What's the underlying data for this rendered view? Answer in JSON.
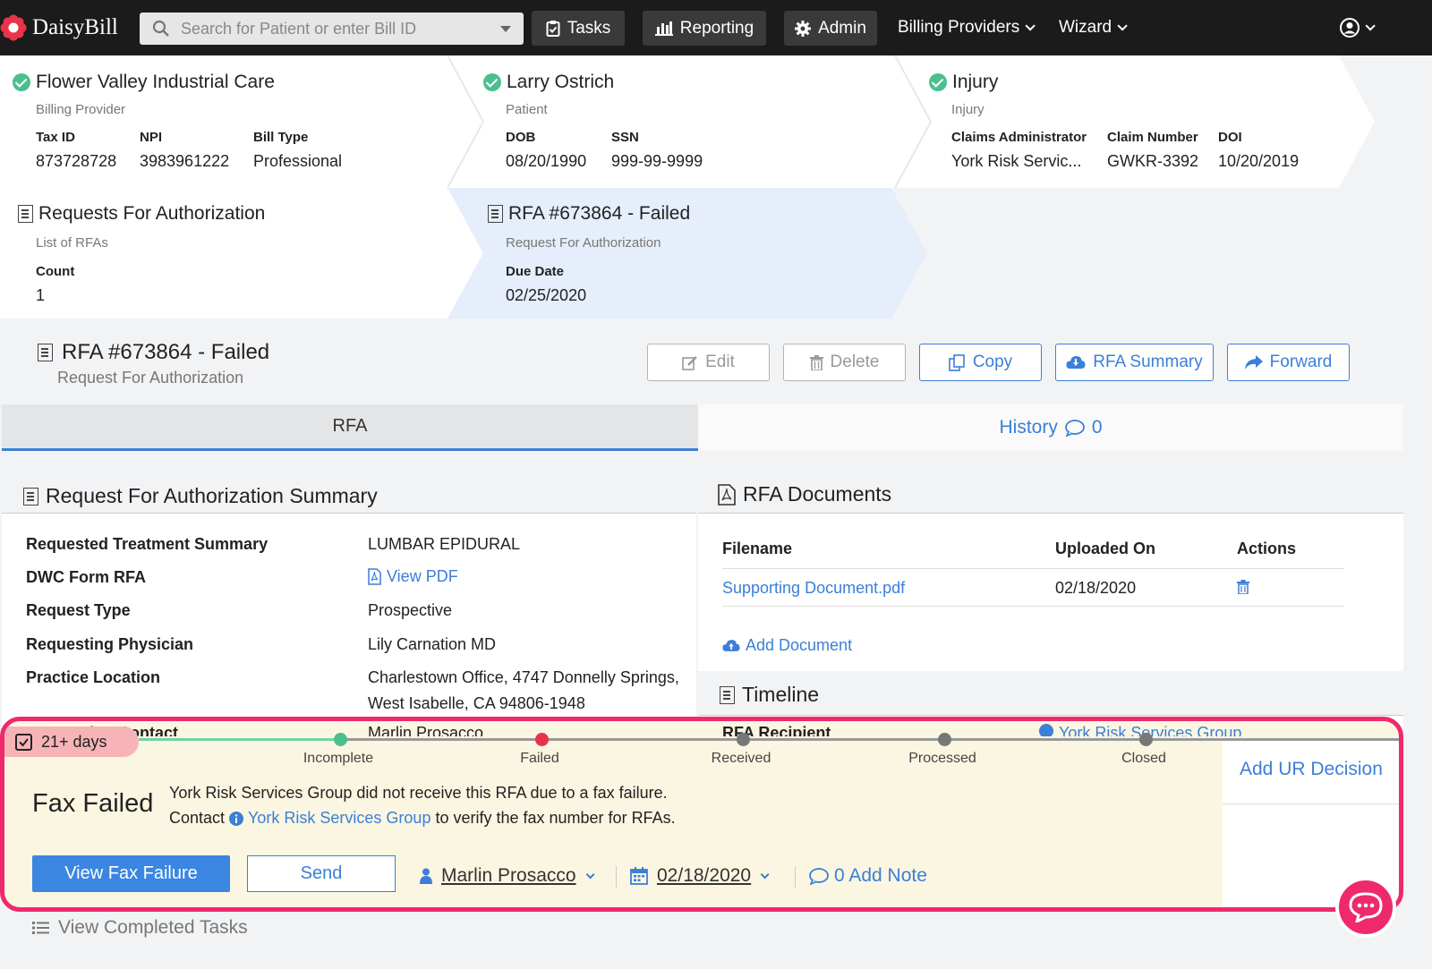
{
  "nav": {
    "brand": "DaisyBill",
    "search_placeholder": "Search for Patient or enter Bill ID",
    "tasks": "Tasks",
    "reporting": "Reporting",
    "admin": "Admin",
    "billing_providers": "Billing Providers",
    "wizard": "Wizard",
    "icons": {
      "search": "search-icon",
      "tasks": "clipboard-check-icon",
      "reporting": "bar-chart-icon",
      "admin": "gear-icon",
      "user": "user-circle-icon"
    }
  },
  "crumbs": {
    "provider": {
      "title": "Flower Valley Industrial Care",
      "sub": "Billing Provider",
      "labels": [
        "Tax ID",
        "NPI",
        "Bill Type"
      ],
      "values": [
        "873728728",
        "3983961222",
        "Professional"
      ]
    },
    "patient": {
      "title": "Larry Ostrich",
      "sub": "Patient",
      "labels": [
        "DOB",
        "SSN"
      ],
      "values": [
        "08/20/1990",
        "999-99-9999"
      ]
    },
    "injury": {
      "title": "Injury",
      "sub": "Injury",
      "labels": [
        "Claims Administrator",
        "Claim Number",
        "DOI"
      ],
      "values": [
        "York Risk Servic...",
        "GWKR-3392",
        "10/20/2019"
      ]
    },
    "rfas": {
      "title": "Requests For Authorization",
      "sub": "List of RFAs",
      "label": "Count",
      "value": "1"
    },
    "current": {
      "title": "RFA #673864 - Failed",
      "sub": "Request For Authorization",
      "label": "Due Date",
      "value": "02/25/2020"
    }
  },
  "header": {
    "title": "RFA #673864 - Failed",
    "sub": "Request For Authorization",
    "buttons": {
      "edit": "Edit",
      "delete": "Delete",
      "copy": "Copy",
      "summary": "RFA Summary",
      "forward": "Forward"
    }
  },
  "tabs": {
    "rfa": "RFA",
    "history": "History",
    "history_count": "0"
  },
  "summary": {
    "heading": "Request For Authorization Summary",
    "rows": [
      {
        "label": "Requested Treatment Summary",
        "value": "LUMBAR EPIDURAL"
      },
      {
        "label": "DWC Form RFA",
        "value": "View PDF"
      },
      {
        "label": "Request Type",
        "value": "Prospective"
      },
      {
        "label": "Requesting Physician",
        "value": "Lily Carnation MD"
      },
      {
        "label": "Practice Location",
        "value": "Charlestown Office, 4747 Donnelly Springs,",
        "value2": "West Isabelle, CA 94806-1948"
      },
      {
        "label": "Requesting Contact",
        "value": "Marlin Prosacco"
      }
    ]
  },
  "documents": {
    "heading": "RFA Documents",
    "columns": [
      "Filename",
      "Uploaded On",
      "Actions"
    ],
    "rows": [
      {
        "filename": "Supporting Document.pdf",
        "uploaded": "02/18/2020"
      }
    ],
    "add": "Add Document"
  },
  "timeline": {
    "heading": "Timeline",
    "recipient_label": "RFA Recipient",
    "recipient_value": "York Risk Services Group"
  },
  "task": {
    "age": "21+ days",
    "stages": [
      "Incomplete",
      "Failed",
      "Received",
      "Processed",
      "Closed"
    ],
    "status_title": "Fax Failed",
    "message_line1": "York Risk Services Group did not receive this RFA due to a fax failure.",
    "message_pre": "Contact",
    "message_link": "York Risk Services Group",
    "message_post": "to verify the fax number for RFAs.",
    "view_fax": "View Fax Failure",
    "send": "Send",
    "assignee": "Marlin Prosacco",
    "date": "02/18/2020",
    "note": "0 Add Note",
    "ur_decision": "Add UR Decision"
  },
  "footer": {
    "completed": "View Completed Tasks"
  },
  "colors": {
    "accent": "#3b7fd6",
    "success": "#4cbf8f",
    "danger": "#e8344a",
    "highlight": "#ee2a6b"
  }
}
